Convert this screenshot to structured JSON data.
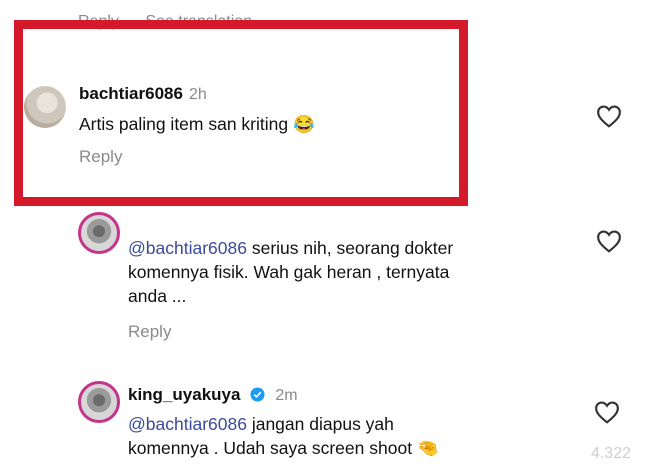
{
  "top": {
    "reply_label": "Reply",
    "translate_label": "See translation"
  },
  "comments": [
    {
      "username": "bachtiar6086",
      "time": "2h",
      "text": "Artis paling item san kriting",
      "emoji": "😂",
      "reply_label": "Reply"
    },
    {
      "username": "",
      "mention": "@bachtiar6086",
      "text": "serius nih, seorang dokter komennya fisik. Wah gak heran , ternyata anda ...",
      "line1": " serius nih, seorang dokter",
      "line2": "komennya fisik. Wah gak heran , ternyata",
      "line3": "anda ...",
      "reply_label": "Reply"
    },
    {
      "username": "king_uyakuya",
      "time": "2m",
      "mention": "@bachtiar6086",
      "line1": " jangan diapus yah",
      "line2": "komennya . Udah saya screen shoot",
      "emoji": "🤏"
    }
  ],
  "counter": "4.322",
  "colors": {
    "highlight": "#d3192a",
    "mention": "#3a4b9c",
    "muted": "#8a8a8a"
  },
  "icons": [
    "heart-icon",
    "verified-badge-icon"
  ]
}
